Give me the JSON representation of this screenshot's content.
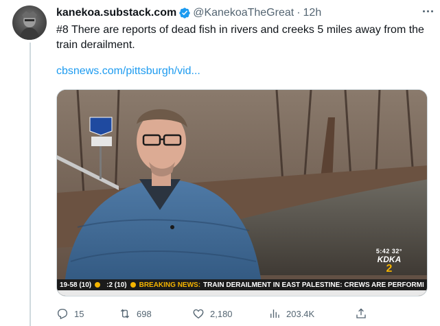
{
  "tweet": {
    "display_name": "kanekoa.substack.com",
    "handle": "@KanekoaTheGreat",
    "separator": "·",
    "time": "12h",
    "text": "#8 There are reports of dead fish in rivers and creeks 5 miles away from the train derailment.",
    "link": "cbsnews.com/pittsburgh/vid..."
  },
  "media": {
    "ticker": {
      "score_a": "19-58 (10)",
      "score_b": ":2 (10)",
      "breaking_label": "BREAKING NEWS:",
      "headline": "TRAIN DERAILMENT IN EAST PALESTINE: CREWS ARE PERFORMI"
    },
    "bug": {
      "time_temp": "5:42  32°",
      "station": "KDKA",
      "channel": "2"
    },
    "road_sign": "",
    "accent_color": "#f5b400"
  },
  "actions": {
    "replies": "15",
    "retweets": "698",
    "likes": "2,180",
    "views": "203.4K"
  },
  "icons": [
    "verified-badge-icon",
    "more-icon",
    "reply-icon",
    "retweet-icon",
    "like-icon",
    "views-icon",
    "share-icon"
  ],
  "colors": {
    "link": "#1d9bf0",
    "muted": "#536471",
    "verified": "#1d9bf0"
  }
}
